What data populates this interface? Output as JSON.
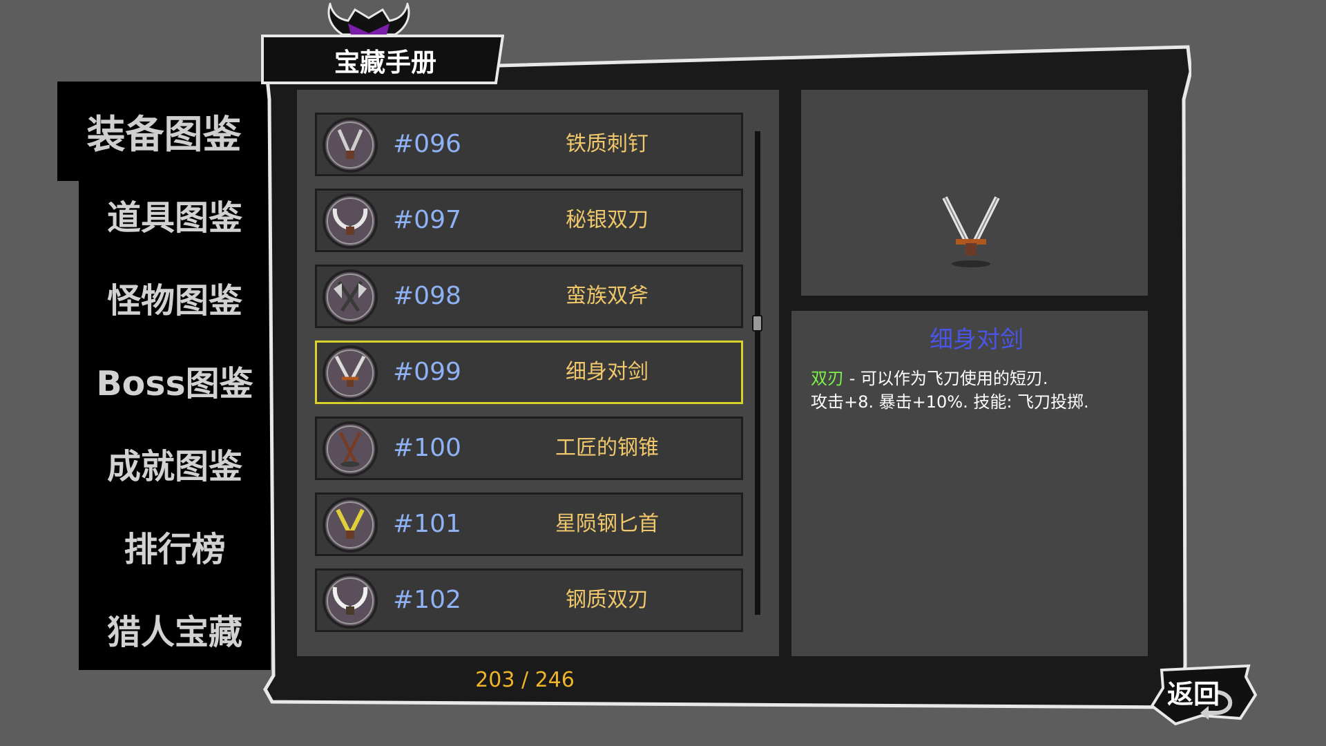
{
  "window": {
    "title": "宝藏手册"
  },
  "side_menu": {
    "items": [
      {
        "label": "装备图鉴",
        "active": true
      },
      {
        "label": "道具图鉴",
        "active": false
      },
      {
        "label": "怪物图鉴",
        "active": false
      },
      {
        "label": "Boss图鉴",
        "active": false
      },
      {
        "label": "成就图鉴",
        "active": false
      },
      {
        "label": "排行榜",
        "active": false
      },
      {
        "label": "猎人宝藏",
        "active": false
      }
    ]
  },
  "list": {
    "rows": [
      {
        "id": "#096",
        "name": "铁质刺钉",
        "icon": "iron-spike-icon",
        "selected": false
      },
      {
        "id": "#097",
        "name": "秘银双刀",
        "icon": "mithril-twin-blades-icon",
        "selected": false
      },
      {
        "id": "#098",
        "name": "蛮族双斧",
        "icon": "barbarian-twin-axes-icon",
        "selected": false
      },
      {
        "id": "#099",
        "name": "细身对剑",
        "icon": "slender-twin-swords-icon",
        "selected": true
      },
      {
        "id": "#100",
        "name": "工匠的钢锥",
        "icon": "craftsman-steel-awl-icon",
        "selected": false
      },
      {
        "id": "#101",
        "name": "星陨钢匕首",
        "icon": "meteor-steel-dagger-icon",
        "selected": false
      },
      {
        "id": "#102",
        "name": "钢质双刃",
        "icon": "steel-twin-edges-icon",
        "selected": false
      }
    ],
    "counter": "203 / 246"
  },
  "detail": {
    "title": "细身对剑",
    "tag": "双刃",
    "line1_rest": " - 可以作为飞刀使用的短刃.",
    "line2": "攻击+8. 暴击+10%. 技能: 飞刀投掷.",
    "preview_icon": "slender-twin-swords-icon"
  },
  "back_button": {
    "label": "返回"
  },
  "colors": {
    "item_id": "#8fb2f5",
    "item_name": "#f0c76b",
    "selected_border": "#d9d22a",
    "detail_title": "#4a55e8",
    "tag": "#7cf24a",
    "counter": "#f0b42a"
  }
}
